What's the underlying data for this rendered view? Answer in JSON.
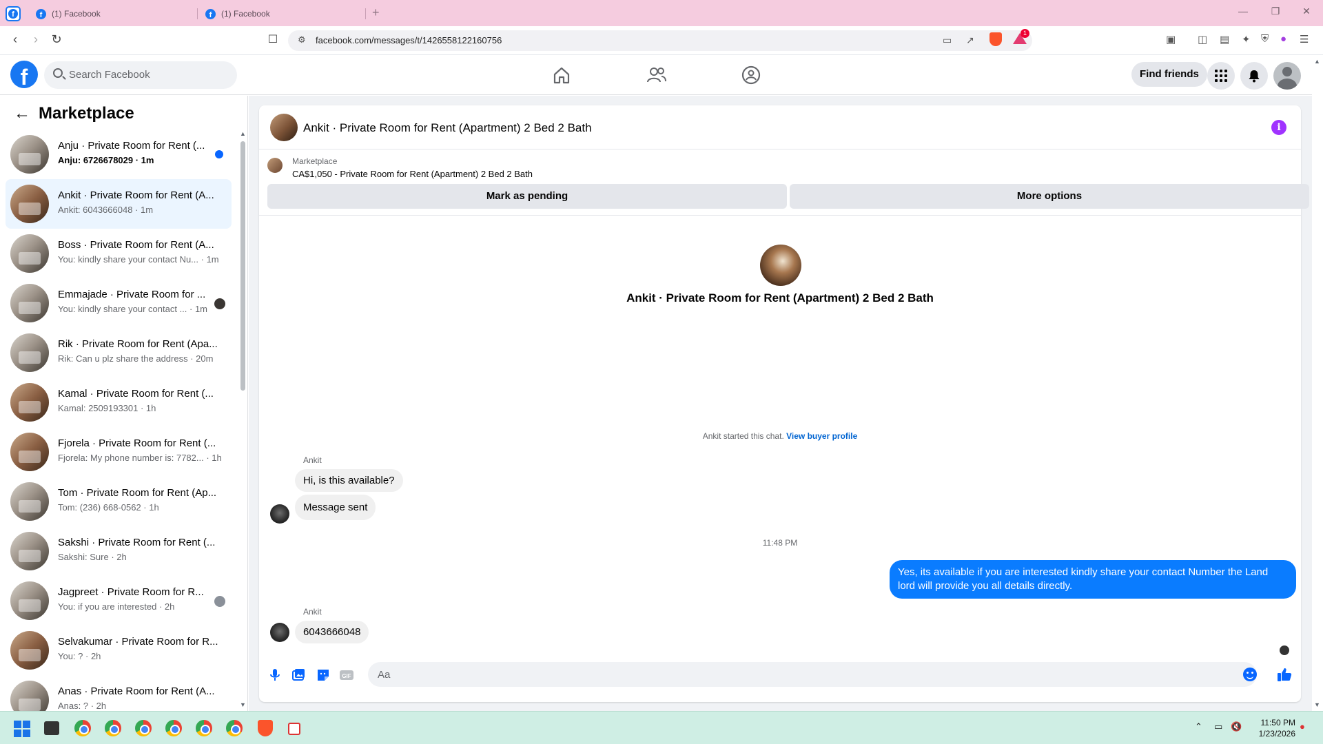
{
  "browser": {
    "tabs": [
      {
        "label": "(1) Facebook"
      },
      {
        "label": "(1) Facebook"
      }
    ],
    "url": "facebook.com/messages/t/1426558122160756",
    "badge_count": "1"
  },
  "fb_header": {
    "search_placeholder": "Search Facebook",
    "find_friends_label": "Find friends"
  },
  "sidebar": {
    "title": "Marketplace",
    "conversations": [
      {
        "name": "Anju · Private Room for Rent (...",
        "snippet": "Anju: 6726678029 · 1m",
        "unread": true
      },
      {
        "name": "Ankit · Private Room for Rent (A...",
        "snippet": "Ankit: 6043666048 · 1m",
        "active": true
      },
      {
        "name": "Boss · Private Room for Rent (A...",
        "snippet": "You: kindly share your contact Nu... · 1m"
      },
      {
        "name": "Emmajade · Private Room for ...",
        "snippet": "You: kindly share your contact ... · 1m"
      },
      {
        "name": "Rik · Private Room for Rent (Apa...",
        "snippet": "Rik: Can u plz share the address · 20m"
      },
      {
        "name": "Kamal · Private Room for Rent (...",
        "snippet": "Kamal: 2509193301 · 1h"
      },
      {
        "name": "Fjorela · Private Room for Rent (...",
        "snippet": "Fjorela: My phone number is: 7782... · 1h"
      },
      {
        "name": "Tom · Private Room for Rent (Ap...",
        "snippet": "Tom: (236) 668-0562 · 1h"
      },
      {
        "name": "Sakshi · Private Room for Rent (...",
        "snippet": "Sakshi: Sure · 2h"
      },
      {
        "name": "Jagpreet · Private Room for R...",
        "snippet": "You: if you are interested · 2h"
      },
      {
        "name": "Selvakumar · Private Room for R...",
        "snippet": "You: ? · 2h"
      },
      {
        "name": "Anas · Private Room for Rent (A...",
        "snippet": "Anas: ? · 2h"
      }
    ]
  },
  "chat": {
    "header_title": "Ankit · Private Room for Rent (Apartment) 2 Bed 2 Bath",
    "listing_source": "Marketplace",
    "listing_item": "CA$1,050 - Private Room for Rent (Apartment) 2 Bed 2 Bath",
    "mark_pending_label": "Mark as pending",
    "more_options_label": "More options",
    "center_title": "Ankit · Private Room for Rent (Apartment) 2 Bed 2 Bath",
    "started_text": "Ankit started this chat.",
    "view_buyer_label": "View buyer profile",
    "messages": [
      {
        "sender": "Ankit",
        "text": "Hi, is this available?"
      },
      {
        "text": "Message sent"
      },
      {
        "timestamp": "11:48 PM"
      },
      {
        "outgoing": true,
        "text": "Yes, its available if you are interested kindly share your contact Number the Land lord will provide you all details directly."
      },
      {
        "sender": "Ankit",
        "text": "6043666048"
      }
    ],
    "composer_placeholder": "Aa"
  },
  "taskbar": {
    "time": "11:50 PM",
    "date": "1/23/2026"
  },
  "colors": {
    "fb_blue": "#1877f2",
    "messenger_out": "#0a7cff",
    "active_conv_bg": "#ebf5ff",
    "tab_strip": "#f5ccdf",
    "taskbar": "#cfeee4"
  }
}
